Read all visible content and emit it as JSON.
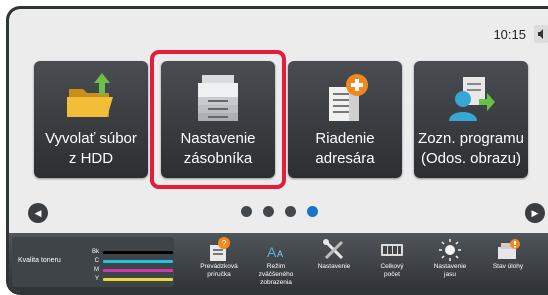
{
  "status": {
    "time": "10:15"
  },
  "tiles": [
    {
      "label": "Vyvolať súbor\nz HDD",
      "icon": "folder-hdd-icon"
    },
    {
      "label": "Nastavenie\nzásobníka",
      "icon": "printer-tray-icon"
    },
    {
      "label": "Riadenie\nadresára",
      "icon": "address-book-icon"
    },
    {
      "label": "Zozn. programu\n(Odos. obrazu)",
      "icon": "program-list-icon"
    }
  ],
  "pager": {
    "pages": 4,
    "active_page": 4
  },
  "toner": {
    "title": "Kvalita toneru",
    "channels": [
      {
        "label": "Bk",
        "color": "#000000"
      },
      {
        "label": "C",
        "color": "#22c4e0"
      },
      {
        "label": "M",
        "color": "#d13ba7"
      },
      {
        "label": "Y",
        "color": "#e5d83a"
      }
    ]
  },
  "functions": [
    {
      "label": "Prevádzková\npríručka",
      "icon": "manual-icon"
    },
    {
      "label": "Režim\nzväčšeného\nzobrazenia",
      "icon": "enlarge-display-icon"
    },
    {
      "label": "Nastavenie",
      "icon": "tools-icon"
    },
    {
      "label": "Celkový\npočet",
      "icon": "counter-icon"
    },
    {
      "label": "Nastavenie\njasu",
      "icon": "brightness-icon"
    },
    {
      "label": "Stav úlohy",
      "icon": "job-status-icon"
    }
  ],
  "colors": {
    "highlight": "#e31d3a",
    "active_dot": "#1a73c9"
  }
}
